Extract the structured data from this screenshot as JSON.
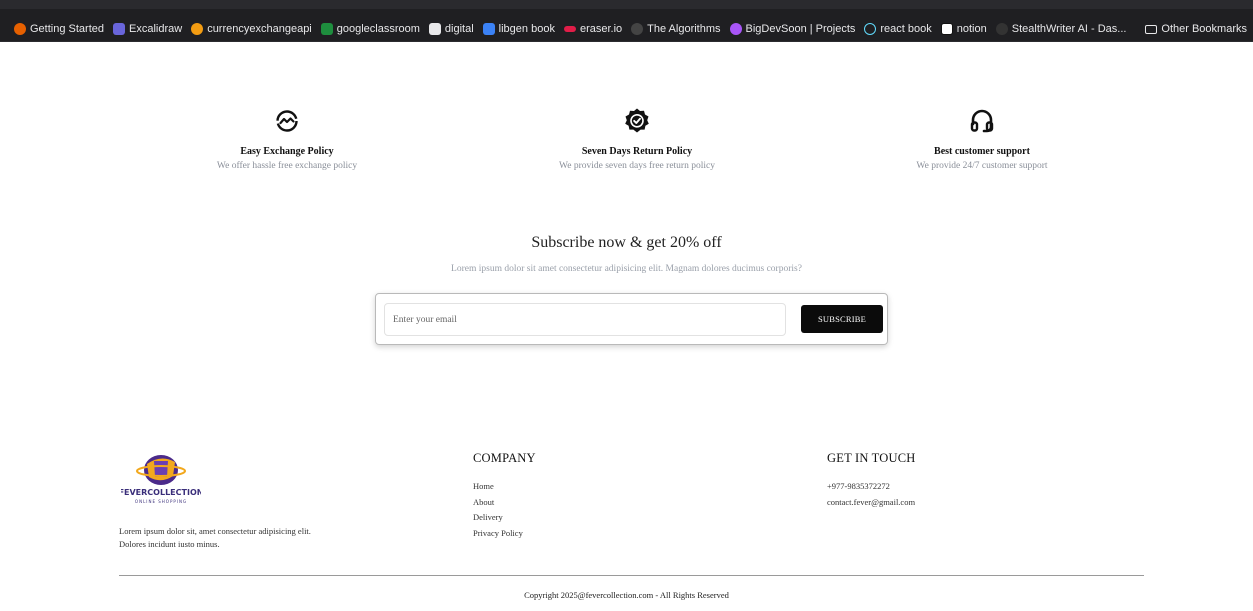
{
  "bookmarks": {
    "items": [
      {
        "label": "Getting Started",
        "color": "#e66000"
      },
      {
        "label": "Excalidraw",
        "color": "#6965db"
      },
      {
        "label": "currencyexchangeapi",
        "color": "#f39c12"
      },
      {
        "label": "googleclassroom",
        "color": "#1e8e3e"
      },
      {
        "label": "digital",
        "color": "#e8e8ea"
      },
      {
        "label": "libgen book",
        "color": "#3b82f6"
      },
      {
        "label": "eraser.io",
        "color": "#e11d48"
      },
      {
        "label": "The Algorithms",
        "color": "#444444"
      },
      {
        "label": "BigDevSoon | Projects",
        "color": "#a855f7"
      },
      {
        "label": "react book",
        "color": "#61dafb"
      },
      {
        "label": "notion",
        "color": "#ffffff"
      },
      {
        "label": "StealthWriter AI - Das...",
        "color": "#333333"
      }
    ],
    "other_label": "Other Bookmarks"
  },
  "policies": [
    {
      "icon": "exchange-icon",
      "title": "Easy Exchange Policy",
      "desc": "We offer hassle free exchange policy"
    },
    {
      "icon": "verified-badge-icon",
      "title": "Seven Days Return Policy",
      "desc": "We provide seven days free return policy"
    },
    {
      "icon": "headset-icon",
      "title": "Best customer support",
      "desc": "We provide 24/7 customer support"
    }
  ],
  "subscribe": {
    "title": "Subscribe now & get 20% off",
    "desc": "Lorem ipsum dolor sit amet consectetur adipisicing elit. Magnam dolores ducimus corporis?",
    "placeholder": "Enter your email",
    "button_label": "SUBSCRIBE"
  },
  "footer": {
    "logo_text": "FEVERCOLLECTION",
    "logo_subtext": "ONLINE SHOPPING",
    "about_line1": "Lorem ipsum dolor sit, amet consectetur adipisicing elit.",
    "about_line2": "Dolores incidunt iusto minus.",
    "company": {
      "title": "COMPANY",
      "links": [
        "Home",
        "About",
        "Delivery",
        "Privacy Policy"
      ]
    },
    "contact": {
      "title": "GET IN TOUCH",
      "phone": "+977-9835372272",
      "email": "contact.fever@gmail.com"
    },
    "copyright": "Copyright 2025@fevercollection.com - All Rights Reserved"
  }
}
